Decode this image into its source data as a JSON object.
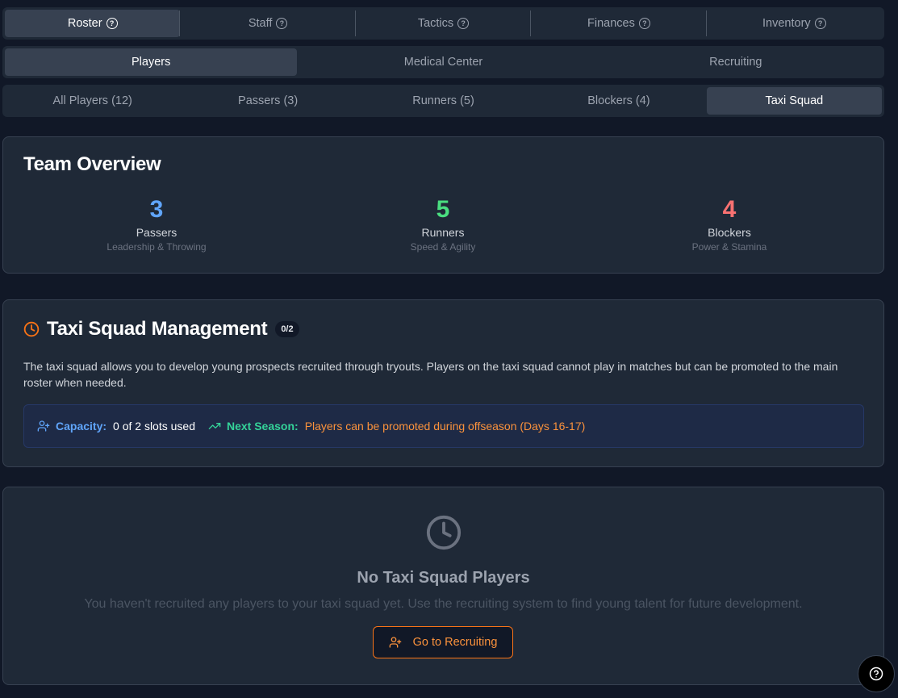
{
  "tabs_primary": [
    {
      "label": "Roster",
      "active": true
    },
    {
      "label": "Staff",
      "active": false
    },
    {
      "label": "Tactics",
      "active": false
    },
    {
      "label": "Finances",
      "active": false
    },
    {
      "label": "Inventory",
      "active": false
    }
  ],
  "tabs_secondary": [
    {
      "label": "Players",
      "active": true
    },
    {
      "label": "Medical Center",
      "active": false
    },
    {
      "label": "Recruiting",
      "active": false
    }
  ],
  "tabs_filter": [
    {
      "label": "All Players (12)",
      "active": false
    },
    {
      "label": "Passers (3)",
      "active": false
    },
    {
      "label": "Runners (5)",
      "active": false
    },
    {
      "label": "Blockers (4)",
      "active": false
    },
    {
      "label": "Taxi Squad",
      "active": true
    }
  ],
  "overview": {
    "title": "Team Overview",
    "stats": [
      {
        "value": "3",
        "label": "Passers",
        "sub": "Leadership & Throwing",
        "color": "#60a5fa"
      },
      {
        "value": "5",
        "label": "Runners",
        "sub": "Speed & Agility",
        "color": "#4ade80"
      },
      {
        "value": "4",
        "label": "Blockers",
        "sub": "Power & Stamina",
        "color": "#f87171"
      }
    ]
  },
  "taxi": {
    "title": "Taxi Squad Management",
    "badge": "0/2",
    "description": "The taxi squad allows you to develop young prospects recruited through tryouts. Players on the taxi squad cannot play in matches but can be promoted to the main roster when needed.",
    "capacity_label": "Capacity:",
    "capacity_value": "0 of 2 slots used",
    "next_label": "Next Season:",
    "next_value": "Players can be promoted during offseason (Days 16-17)"
  },
  "empty": {
    "title": "No Taxi Squad Players",
    "text": "You haven't recruited any players to your taxi squad yet. Use the recruiting system to find young talent for future development.",
    "button": "Go to Recruiting"
  },
  "icons": {
    "help": "help-circle-icon",
    "clock": "clock-icon",
    "users_plus": "user-plus-icon",
    "trending": "trending-up-icon"
  },
  "colors": {
    "accent": "#f97316",
    "passers": "#60a5fa",
    "runners": "#4ade80",
    "blockers": "#f87171"
  }
}
